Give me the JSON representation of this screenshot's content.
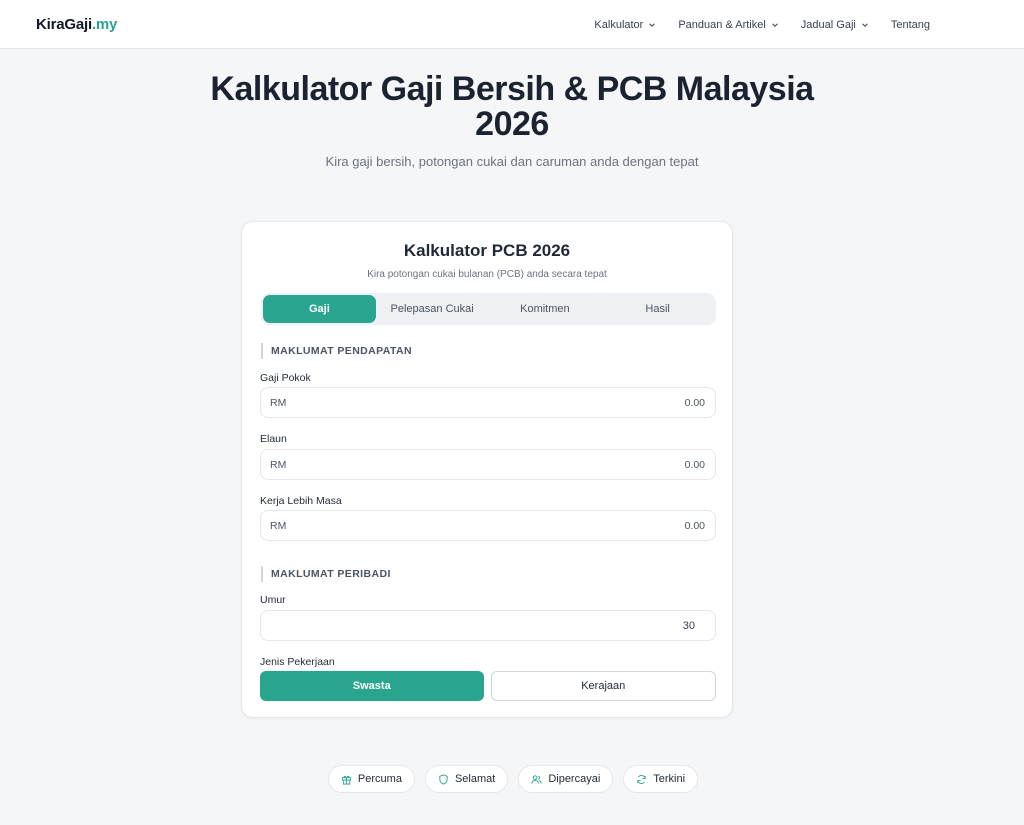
{
  "header": {
    "logo_main": "KiraGaji",
    "logo_tld": ".my",
    "nav": [
      {
        "label": "Kalkulator",
        "dropdown": true
      },
      {
        "label": "Panduan & Artikel",
        "dropdown": true
      },
      {
        "label": "Jadual Gaji",
        "dropdown": true
      },
      {
        "label": "Tentang",
        "dropdown": false
      }
    ]
  },
  "hero": {
    "title_line1": "Kalkulator Gaji Bersih & PCB Malaysia",
    "title_line2": "2026",
    "subtitle": "Kira gaji bersih, potongan cukai dan caruman anda dengan tepat"
  },
  "card": {
    "title": "Kalkulator PCB 2026",
    "subtitle": "Kira potongan cukai bulanan (PCB) anda secara tepat",
    "tabs": [
      {
        "label": "Gaji",
        "active": true
      },
      {
        "label": "Pelepasan Cukai",
        "active": false
      },
      {
        "label": "Komitmen",
        "active": false
      },
      {
        "label": "Hasil",
        "active": false
      }
    ],
    "section_income": "MAKLUMAT PENDAPATAN",
    "fields": [
      {
        "label": "Gaji Pokok",
        "prefix": "RM",
        "value": "0.00"
      },
      {
        "label": "Elaun",
        "prefix": "RM",
        "value": "0.00"
      },
      {
        "label": "Kerja Lebih Masa",
        "prefix": "RM",
        "value": "0.00"
      }
    ],
    "section_personal": "MAKLUMAT PERIBADI",
    "age_label": "Umur",
    "age_value": "30",
    "job_label": "Jenis Pekerjaan",
    "job_options": [
      {
        "label": "Swasta",
        "selected": true
      },
      {
        "label": "Kerajaan",
        "selected": false
      }
    ]
  },
  "badges": [
    {
      "label": "Percuma",
      "icon": "gift-icon"
    },
    {
      "label": "Selamat",
      "icon": "shield-icon"
    },
    {
      "label": "Dipercayai",
      "icon": "users-icon"
    },
    {
      "label": "Terkini",
      "icon": "refresh-icon"
    }
  ],
  "colors": {
    "accent": "#2aa58d",
    "background": "#f5f6f8",
    "text": "#1f2937"
  }
}
